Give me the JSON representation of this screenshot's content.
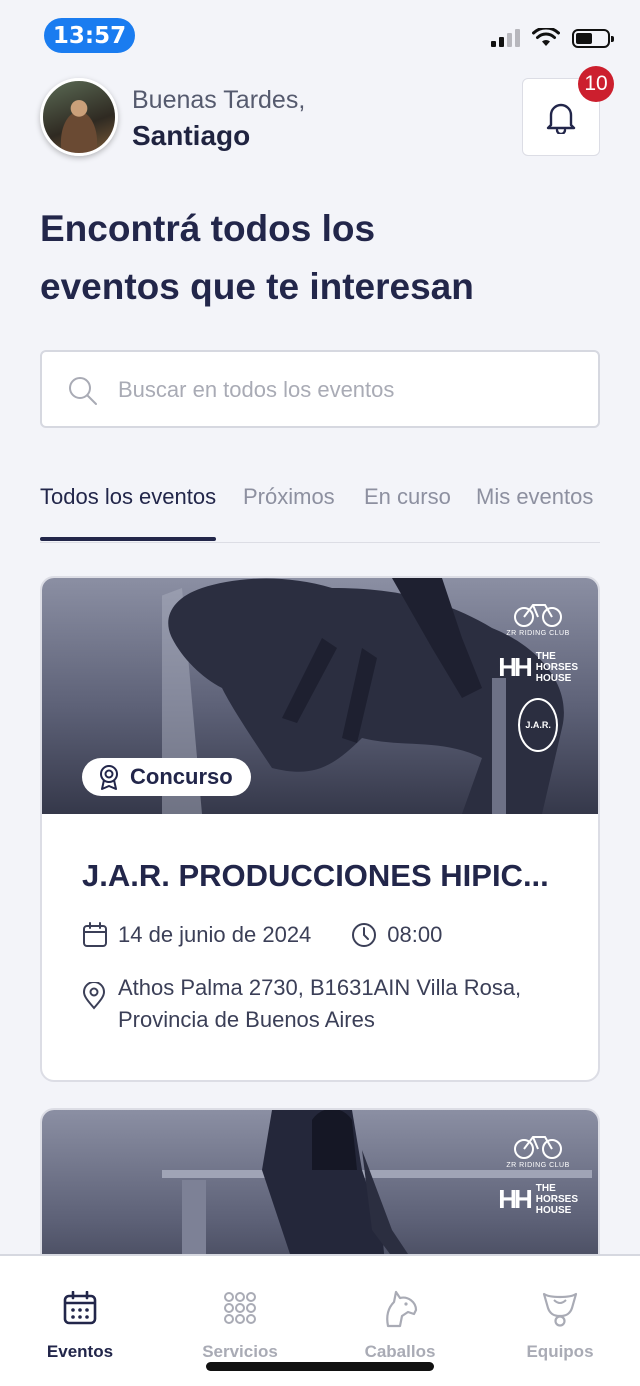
{
  "status_bar": {
    "time": "13:57",
    "accent": "#1a7cf0"
  },
  "header": {
    "greeting": "Buenas Tardes,",
    "username": "Santiago",
    "notifications_count": "10",
    "avatar_icon": "user-avatar"
  },
  "headline": {
    "line1": "Encontrá todos los",
    "line2": "eventos que te interesan"
  },
  "search": {
    "placeholder": "Buscar en todos los eventos",
    "value": ""
  },
  "tabs": [
    {
      "label": "Todos los eventos",
      "active": true
    },
    {
      "label": "Próximos",
      "active": false
    },
    {
      "label": "En curso",
      "active": false
    },
    {
      "label": "Mis eventos",
      "active": false
    }
  ],
  "events": [
    {
      "category": "Concurso",
      "title": "J.A.R. PRODUCCIONES HIPIC...",
      "date": "14 de junio de 2024",
      "time": "08:00",
      "address": "Athos Palma 2730, B1631AIN Villa Rosa, Provincia de Buenos Aires",
      "logos": {
        "zr": "ZR RIDING CLUB",
        "hh_line1": "THE",
        "hh_line2": "HORSES",
        "hh_line3": "HOUSE",
        "jar": "J.A.R."
      }
    },
    {
      "logos": {
        "zr": "ZR RIDING CLUB",
        "hh_line1": "THE",
        "hh_line2": "HORSES",
        "hh_line3": "HOUSE"
      }
    }
  ],
  "bottom_nav": [
    {
      "label": "Eventos",
      "icon": "calendar-icon",
      "active": true
    },
    {
      "label": "Servicios",
      "icon": "grid-icon",
      "active": false
    },
    {
      "label": "Caballos",
      "icon": "horse-icon",
      "active": false
    },
    {
      "label": "Equipos",
      "icon": "saddle-icon",
      "active": false
    }
  ],
  "colors": {
    "primary": "#22264a",
    "badge": "#cc1f2e",
    "background": "#f3f4f9",
    "inactive": "#a9abb5"
  }
}
